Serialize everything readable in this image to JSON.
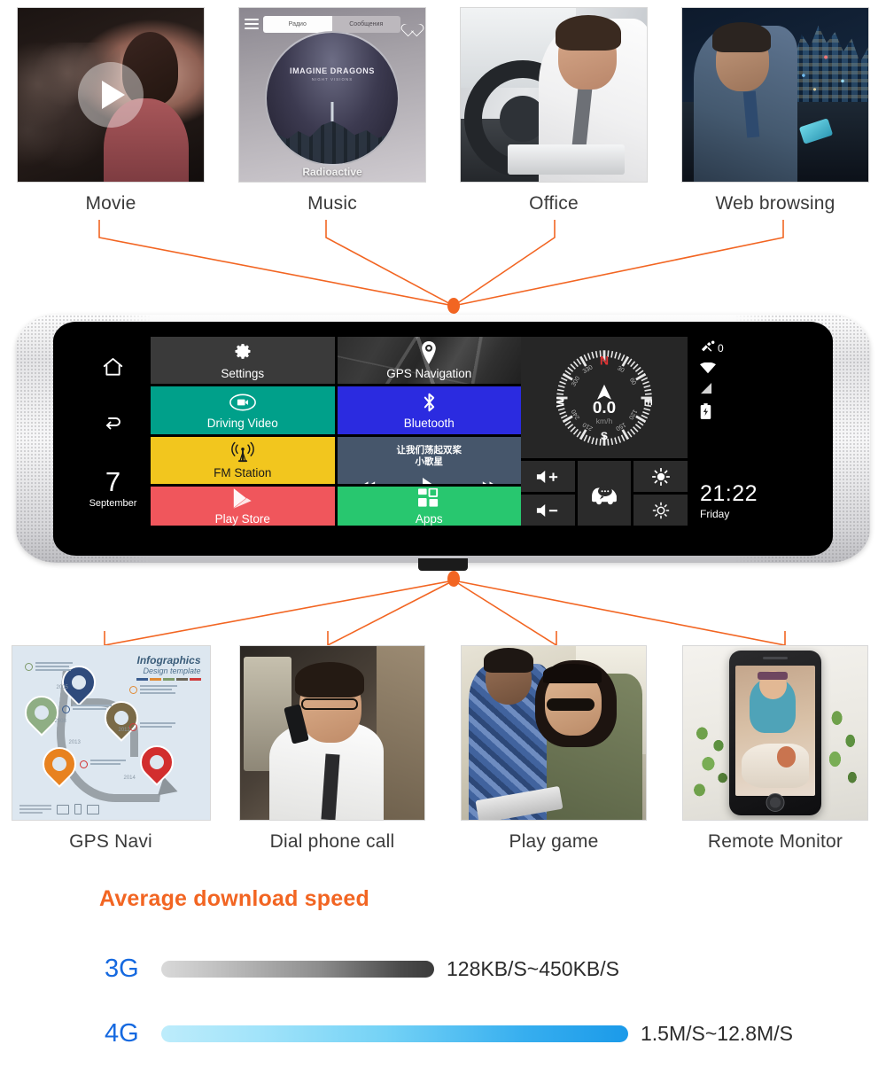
{
  "top_features": [
    {
      "label": "Movie",
      "thumb": "movie-scene-thumbnail",
      "overlay_icon": "play-icon"
    },
    {
      "label": "Music",
      "thumb": "music-player-thumbnail",
      "tab_radio": "Радио",
      "tab_messages": "Сообщения",
      "album_artist": "IMAGINE DRAGONS",
      "album_sub": "NIGHT VISIONS",
      "track": "Radioactive"
    },
    {
      "label": "Office",
      "thumb": "office-in-car-thumbnail"
    },
    {
      "label": "Web browsing",
      "thumb": "web-browsing-in-car-thumbnail"
    }
  ],
  "bottom_features": [
    {
      "label": "GPS Navi",
      "thumb": "gps-infographic-thumbnail",
      "ig_title": "Infographics",
      "ig_subtitle": "Design template",
      "years": [
        "2005",
        "2008",
        "2012",
        "2013",
        "2014"
      ]
    },
    {
      "label": "Dial phone call",
      "thumb": "dial-phone-call-thumbnail"
    },
    {
      "label": "Play game",
      "thumb": "play-game-thumbnail"
    },
    {
      "label": "Remote Monitor",
      "thumb": "remote-monitor-thumbnail"
    }
  ],
  "device": {
    "nav": {
      "home_icon": "home-icon",
      "back_icon": "back-arrow-icon",
      "date_day": "7",
      "date_month": "September"
    },
    "tiles": [
      {
        "id": "settings",
        "label": "Settings",
        "icon": "gear-icon",
        "color": "#3a3a3a"
      },
      {
        "id": "gps",
        "label": "GPS Navigation",
        "icon": "location-pin-icon",
        "color": "#2f2f2f"
      },
      {
        "id": "driving",
        "label": "Driving Video",
        "icon": "video-camera-icon",
        "color": "#00a08a"
      },
      {
        "id": "bluetooth",
        "label": "Bluetooth",
        "icon": "bluetooth-icon",
        "color": "#2b2be0"
      },
      {
        "id": "fm",
        "label": "FM Station",
        "icon": "radio-tower-icon",
        "color": "#f2c61e"
      },
      {
        "id": "music",
        "label": "",
        "icon": "media-controls",
        "color": "#46566b"
      },
      {
        "id": "playstore",
        "label": "Play Store",
        "icon": "play-store-icon",
        "color": "#f0565c"
      },
      {
        "id": "apps",
        "label": "Apps",
        "icon": "apps-grid-icon",
        "color": "#28c76f"
      }
    ],
    "music_player": {
      "title": "让我们荡起双桨",
      "artist": "小歌星",
      "prev_icon": "rewind-icon",
      "play_icon": "play-icon",
      "next_icon": "fast-forward-icon"
    },
    "gauge": {
      "speed": "0.0",
      "unit": "km/h",
      "north": "N",
      "east": "E",
      "south": "S",
      "west": "W",
      "degrees": [
        "30",
        "60",
        "120",
        "150",
        "210",
        "240",
        "300",
        "330"
      ],
      "needle_icon": "compass-needle-icon"
    },
    "controls": [
      {
        "id": "volume-up",
        "icon": "volume-up-icon"
      },
      {
        "id": "volume-down",
        "icon": "volume-down-icon"
      },
      {
        "id": "car-assistant",
        "icon": "car-chat-icon"
      },
      {
        "id": "brightness-up",
        "icon": "brightness-high-icon"
      },
      {
        "id": "brightness-down",
        "icon": "brightness-low-icon"
      }
    ],
    "status": {
      "gps_icon": "satellite-icon",
      "gps_count": "0",
      "wifi_icon": "wifi-icon",
      "signal_icon": "signal-icon",
      "battery_icon": "battery-charging-icon",
      "time": "21:22",
      "weekday": "Friday"
    }
  },
  "speed_section": {
    "title": "Average download speed",
    "rows": [
      {
        "tag": "3G",
        "value": "128KB/S~450KB/S"
      },
      {
        "tag": "4G",
        "value": "1.5M/S~12.8M/S"
      }
    ]
  },
  "colors": {
    "accent_orange": "#f26522",
    "tag_blue": "#1569e0",
    "connector": "#f26522"
  },
  "chart_data": {
    "type": "bar",
    "title": "Average download speed",
    "orientation": "horizontal",
    "categories": [
      "3G",
      "4G"
    ],
    "values": [
      308,
      527
    ],
    "value_labels": [
      "128KB/S~450KB/S",
      "1.5M/S~12.8M/S"
    ],
    "ranges_mbps": [
      [
        0.128,
        0.45
      ],
      [
        1.5,
        12.8
      ]
    ],
    "xlabel": "",
    "ylabel": "",
    "grid": false,
    "legend": "none"
  }
}
